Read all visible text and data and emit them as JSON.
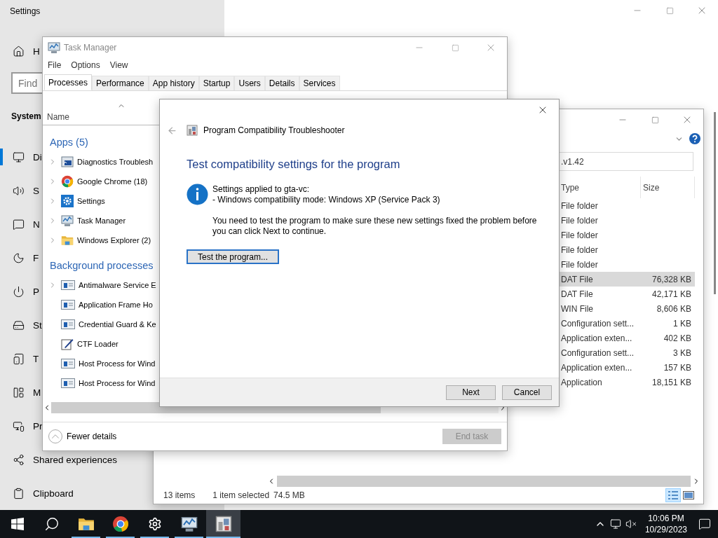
{
  "settings": {
    "title": "Settings",
    "home": {
      "label": "H"
    },
    "search": {
      "placeholder": "Find"
    },
    "heading": "System",
    "nav": [
      {
        "label": "Di",
        "selected": true
      },
      {
        "label": "S",
        "selected": false
      },
      {
        "label": "N",
        "selected": false
      },
      {
        "label": "F",
        "selected": false
      },
      {
        "label": "P",
        "selected": false
      },
      {
        "label": "St",
        "selected": false
      },
      {
        "label": "T",
        "selected": false
      },
      {
        "label": "M",
        "selected": false
      },
      {
        "label": "Pr",
        "selected": false
      },
      {
        "label": "Shared experiences",
        "selected": false
      },
      {
        "label": "Clipboard",
        "selected": false
      }
    ]
  },
  "explorer": {
    "address": ".v1.42",
    "columns": [
      "Type",
      "Size"
    ],
    "rows": [
      {
        "type": "File folder",
        "selected": false
      },
      {
        "type": "File folder",
        "selected": false
      },
      {
        "type": "File folder",
        "selected": false
      },
      {
        "type": "File folder",
        "selected": false
      },
      {
        "type": "File folder",
        "selected": false
      },
      {
        "type": "DAT File",
        "size": "76,328 KB",
        "selected": true
      },
      {
        "type": "DAT File",
        "size": "42,171 KB",
        "selected": false
      },
      {
        "type": "WIN File",
        "size": "8,606 KB",
        "selected": false
      },
      {
        "type": "Configuration sett...",
        "size": "1 KB",
        "selected": false
      },
      {
        "type": "Application exten...",
        "size": "402 KB",
        "selected": false
      },
      {
        "type": "Configuration sett...",
        "size": "3 KB",
        "selected": false
      },
      {
        "type": "Application exten...",
        "size": "157 KB",
        "selected": false
      },
      {
        "type": "Application",
        "size": "18,151 KB",
        "selected": false
      }
    ],
    "status": [
      "13 items",
      "1 item selected",
      "74.5 MB"
    ],
    "views": [
      {
        "selected": true
      },
      {
        "selected": false
      }
    ]
  },
  "task_manager": {
    "title": "Task Manager",
    "menu": [
      "File",
      "Options",
      "View"
    ],
    "tabs": [
      {
        "label": "Processes",
        "selected": true
      },
      {
        "label": "Performance",
        "selected": false
      },
      {
        "label": "App history",
        "selected": false
      },
      {
        "label": "Startup",
        "selected": false
      },
      {
        "label": "Users",
        "selected": false
      },
      {
        "label": "Details",
        "selected": false
      },
      {
        "label": "Services",
        "selected": false
      }
    ],
    "column": "Name",
    "groups": [
      {
        "title": "Apps (5)",
        "rows": [
          {
            "name": "Diagnostics Troublesh",
            "expandable": true
          },
          {
            "name": "Google Chrome (18)",
            "expandable": true
          },
          {
            "name": "Settings",
            "expandable": true
          },
          {
            "name": "Task Manager",
            "expandable": true
          },
          {
            "name": "Windows Explorer (2)",
            "expandable": true
          }
        ]
      },
      {
        "title": "Background processes",
        "rows": [
          {
            "name": "Antimalware Service E",
            "expandable": true
          },
          {
            "name": "Application Frame Ho",
            "expandable": false
          },
          {
            "name": "Credential Guard & Ke",
            "expandable": false
          },
          {
            "name": "CTF Loader",
            "expandable": false
          },
          {
            "name": "Host Process for Wind",
            "expandable": false
          },
          {
            "name": "Host Process for Wind",
            "expandable": false
          }
        ]
      }
    ],
    "fewer_details": "Fewer details",
    "end_task": {
      "label": "End task",
      "disabled": true
    }
  },
  "dialog": {
    "title": "Program Compatibility Troubleshooter",
    "heading": "Test compatibility settings for the program",
    "applied": "Settings applied to gta-vc:",
    "mode": "- Windows compatibility mode: Windows XP (Service Pack 3)",
    "note": "You need to test the program to make sure these new settings fixed the problem before you can click Next to continue.",
    "test_button": "Test the program...",
    "buttons": [
      "Next",
      "Cancel"
    ]
  },
  "taskbar": {
    "apps": [
      {
        "running": true,
        "active": false
      },
      {
        "running": true,
        "active": false
      },
      {
        "running": true,
        "active": false
      },
      {
        "running": true,
        "active": false
      },
      {
        "running": true,
        "active": true
      }
    ],
    "time": "10:06 PM",
    "date": "10/29/2023"
  }
}
